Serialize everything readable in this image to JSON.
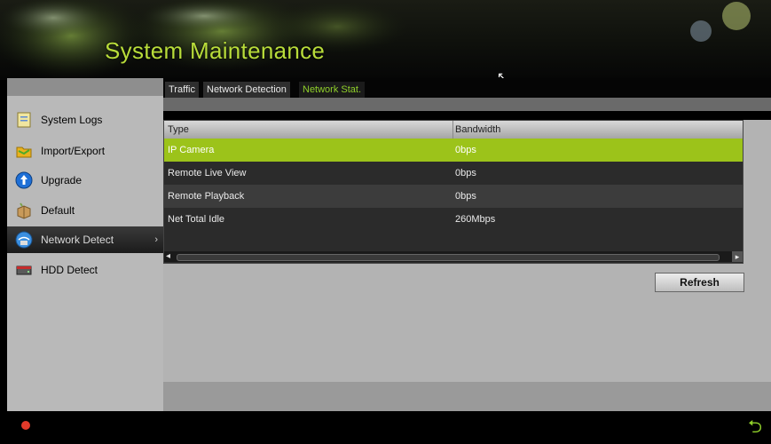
{
  "header": {
    "title": "System Maintenance"
  },
  "tabs": [
    {
      "label": "Traffic",
      "active": false
    },
    {
      "label": "Network Detection",
      "active": false
    },
    {
      "label": "Network Stat.",
      "active": true
    }
  ],
  "sidebar": {
    "items": [
      {
        "label": "System Logs",
        "icon": "document-icon"
      },
      {
        "label": "Import/Export",
        "icon": "folder-icon"
      },
      {
        "label": "Upgrade",
        "icon": "upgrade-icon"
      },
      {
        "label": "Default",
        "icon": "box-icon"
      },
      {
        "label": "Network Detect",
        "icon": "network-icon",
        "active": true
      },
      {
        "label": "HDD Detect",
        "icon": "hdd-icon"
      }
    ]
  },
  "table": {
    "columns": [
      "Type",
      "Bandwidth"
    ],
    "rows": [
      {
        "type": "IP Camera",
        "bandwidth": "0bps",
        "selected": true
      },
      {
        "type": "Remote Live View",
        "bandwidth": "0bps"
      },
      {
        "type": "Remote Playback",
        "bandwidth": "0bps"
      },
      {
        "type": "Net Total Idle",
        "bandwidth": "260Mbps"
      }
    ]
  },
  "buttons": {
    "refresh": "Refresh"
  },
  "colors": {
    "accent": "#9cc31a",
    "title": "#b8dc3a"
  }
}
